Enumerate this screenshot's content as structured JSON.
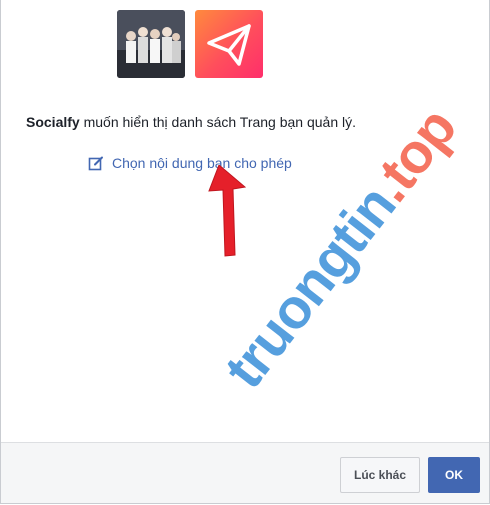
{
  "app": {
    "name": "Socialfy"
  },
  "message": {
    "app_name": "Socialfy",
    "rest": " muốn hiển thị danh sách Trang bạn quản lý."
  },
  "choose_link": {
    "label": "Chọn nội dung bạn cho phép",
    "icon": "edit-icon"
  },
  "buttons": {
    "later": "Lúc khác",
    "ok": "OK"
  },
  "watermark": {
    "text_main": "truongtin",
    "text_tld": ".top"
  },
  "colors": {
    "link": "#4267b2",
    "primary_button": "#4267b2",
    "arrow": "#e5202a",
    "app_gradient_start": "#ff8a3d",
    "app_gradient_end": "#ff2e6b"
  }
}
